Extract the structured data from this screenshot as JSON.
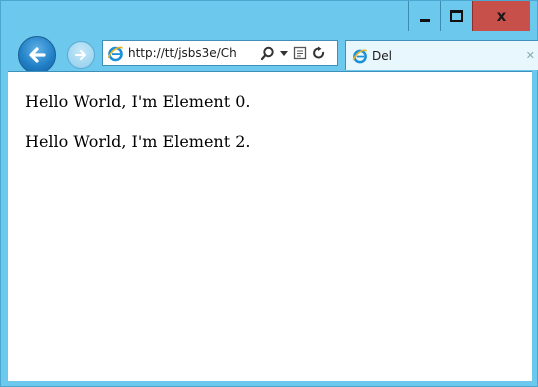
{
  "window": {
    "caption_buttons": {
      "close_label": "x"
    }
  },
  "address_bar": {
    "url": "http://tt/jsbs3e/Ch",
    "icons": [
      "ie-logo-icon",
      "search-icon",
      "dropdown-icon",
      "compatibility-icon",
      "refresh-icon"
    ]
  },
  "tab": {
    "title": "Del"
  },
  "page": {
    "lines": [
      "Hello World, I'm Element 0.",
      "Hello World, I'm Element 2."
    ]
  },
  "colors": {
    "frame": "#6cc8ec",
    "close_button": "#c7504b",
    "back_button": "#1f7dc5"
  }
}
